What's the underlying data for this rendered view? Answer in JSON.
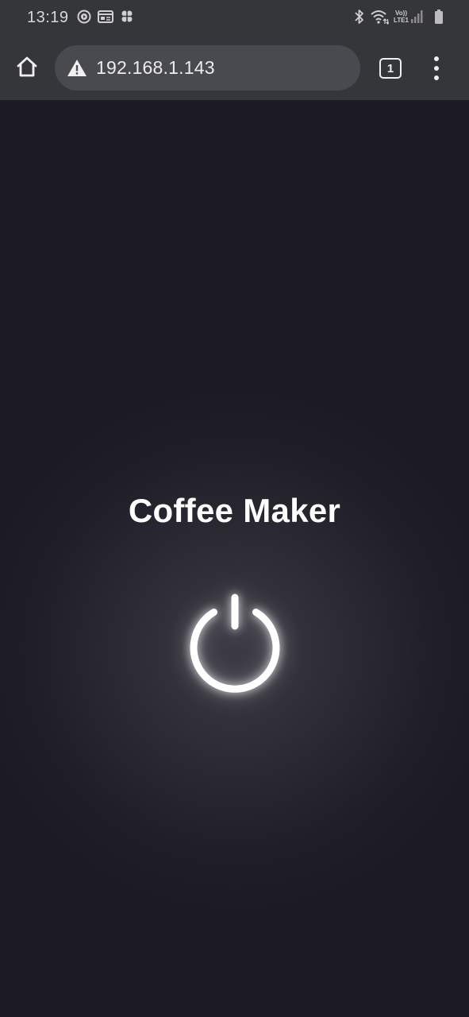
{
  "status_bar": {
    "time": "13:19",
    "left_icons": [
      "play-circle-icon",
      "window-icon",
      "clover-icon"
    ],
    "right_icons": [
      "bluetooth-icon",
      "wifi-icon",
      "volte-signal-icon",
      "battery-icon"
    ],
    "lte_top": "Vo))",
    "lte_bottom": "LTE1"
  },
  "toolbar": {
    "url": "192.168.1.143",
    "tab_count": "1",
    "home_icon": "home-icon",
    "security_icon": "warning-icon",
    "menu_icon": "more-vert-icon"
  },
  "page": {
    "title": "Coffee Maker",
    "power_icon": "power-icon"
  },
  "colors": {
    "background": "#1c1b24",
    "toolbar": "#35363a",
    "url_box": "#494a4f",
    "text": "#ffffff"
  }
}
